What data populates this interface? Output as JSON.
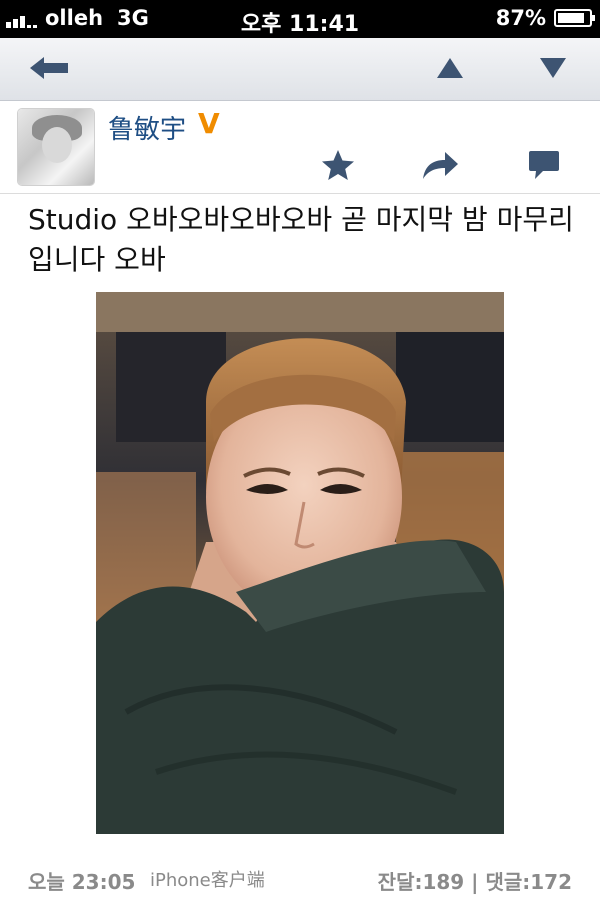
{
  "status_bar": {
    "carrier": "olleh",
    "network": "3G",
    "time": "오후 11:41",
    "battery": "87%",
    "battery_level": 0.87
  },
  "nav_bar": {
    "back_icon": "back-arrow-icon",
    "prev_icon": "triangle-up-icon",
    "next_icon": "triangle-down-icon"
  },
  "post": {
    "author_name": "鲁敏宇",
    "verified_badge": "V",
    "text": "Studio 오바오바오바오바 곧 마지막 밤 마무리 입니다 오바",
    "time": "오늘 23:05",
    "source": "iPhone客户端",
    "counts": "잔달:189 | 댓글:172"
  },
  "actions": {
    "favorite_icon": "star-icon",
    "forward_icon": "forward-arrow-icon",
    "comment_icon": "speech-bubble-icon"
  },
  "colors": {
    "icon": "#3d5472",
    "author_name": "#1e4e84",
    "badge": "#f08c00"
  }
}
